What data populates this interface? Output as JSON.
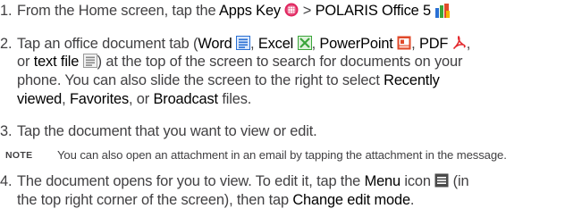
{
  "steps": [
    {
      "num": "1.",
      "lines": [
        {
          "a": "From the Home screen, tap the ",
          "b": "Apps Key",
          "c": " > ",
          "d": "POLARIS Office 5"
        }
      ]
    },
    {
      "num": "2.",
      "lines": [
        {
          "a": "Tap an office document tab (",
          "word": "Word",
          "excel": "Excel",
          "ppt": "PowerPoint",
          "pdf": "PDF",
          "comma": ","
        },
        {
          "a": "or ",
          "b": "text file",
          "c": ") at the top of the screen to search for documents on your"
        },
        {
          "a": "phone. You can also slide the screen to the right to select ",
          "b": "Recently"
        },
        {
          "a": "viewed",
          "b": ", ",
          "c": "Favorites",
          "d": ", or ",
          "e": "Broadcast",
          "f": " files."
        }
      ]
    },
    {
      "num": "3.",
      "lines": [
        {
          "a": "Tap the document that you want to view or edit."
        }
      ]
    },
    {
      "num": "4.",
      "lines": [
        {
          "a": "The document opens for you to view. To edit it, tap the ",
          "b": "Menu",
          "c": " icon ",
          "d": " (in"
        },
        {
          "a": "the top right corner of the screen), then tap ",
          "b": "Change edit mode",
          "c": "."
        }
      ]
    }
  ],
  "note": {
    "label": "NOTE",
    "text": "You can also open an attachment in an email by tapping the attachment in the message."
  },
  "icons": {
    "apps_key": "apps-key-icon",
    "polaris": "polaris-office-icon",
    "word": "word-icon",
    "excel": "excel-icon",
    "ppt": "powerpoint-icon",
    "pdf": "pdf-icon",
    "text": "text-file-icon",
    "menu": "menu-icon"
  },
  "colors": {
    "text": "#414042",
    "emph": "#000000",
    "apps_key": "#e0245e",
    "word": "#2a70d4",
    "excel": "#3aa53a",
    "ppt": "#e04a2a",
    "pdf": "#e3262b"
  },
  "separators": {
    "comma_space": ", ",
    "space_paren_open": " (",
    "close_paren_comma": "), ",
    "close_paren": ")"
  }
}
